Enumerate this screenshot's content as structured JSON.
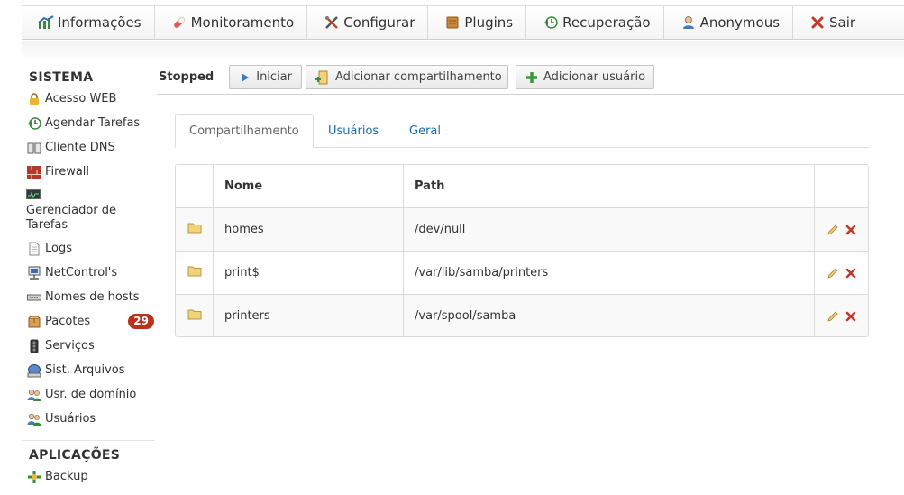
{
  "topnav": {
    "items": [
      {
        "label": "Informações",
        "icon": "chart-icon"
      },
      {
        "label": "Monitoramento",
        "icon": "pill-icon"
      },
      {
        "label": "Configurar",
        "icon": "tools-icon"
      },
      {
        "label": "Plugins",
        "icon": "plugin-icon"
      },
      {
        "label": "Recuperação",
        "icon": "restore-icon"
      },
      {
        "label": "Anonymous",
        "icon": "user-icon"
      },
      {
        "label": "Sair",
        "icon": "close-icon"
      }
    ]
  },
  "sidebar": {
    "sistema_header": "SISTEMA",
    "items": [
      {
        "label": "Acesso WEB",
        "icon": "lock-icon"
      },
      {
        "label": "Agendar Tarefas",
        "icon": "clock-icon"
      },
      {
        "label": "Cliente DNS",
        "icon": "book-icon"
      },
      {
        "label": "Firewall",
        "icon": "firewall-icon"
      },
      {
        "label": "Gerenciador de Tarefas",
        "icon": "monitor-icon"
      },
      {
        "label": "Logs",
        "icon": "document-icon"
      },
      {
        "label": "NetControl's",
        "icon": "network-icon"
      },
      {
        "label": "Nomes de hosts",
        "icon": "hosts-icon"
      },
      {
        "label": "Pacotes",
        "icon": "package-icon",
        "badge": "29"
      },
      {
        "label": "Serviços",
        "icon": "traffic-light-icon"
      },
      {
        "label": "Sist. Arquivos",
        "icon": "disk-icon"
      },
      {
        "label": "Usr. de domínio",
        "icon": "users-icon"
      },
      {
        "label": "Usuários",
        "icon": "users-icon"
      }
    ],
    "aplicacoes_header": "APLICAÇÕES",
    "app_items": [
      {
        "label": "Backup",
        "icon": "backup-icon"
      }
    ]
  },
  "toolbar": {
    "status": "Stopped",
    "start_label": "Iniciar",
    "add_share_label": "Adicionar compartilhamento",
    "add_user_label": "Adicionar usuário"
  },
  "tabs": [
    {
      "label": "Compartilhamento",
      "active": true
    },
    {
      "label": "Usuários",
      "active": false
    },
    {
      "label": "Geral",
      "active": false
    }
  ],
  "table": {
    "columns": [
      "",
      "Nome",
      "Path",
      ""
    ],
    "rows": [
      {
        "name": "homes",
        "path": "/dev/null"
      },
      {
        "name": "print$",
        "path": "/var/lib/samba/printers"
      },
      {
        "name": "printers",
        "path": "/var/spool/samba"
      }
    ]
  },
  "colors": {
    "badge": "#b8321c",
    "link": "#1a6aa6",
    "delete": "#c0392b",
    "folder": "#f2d27a"
  }
}
